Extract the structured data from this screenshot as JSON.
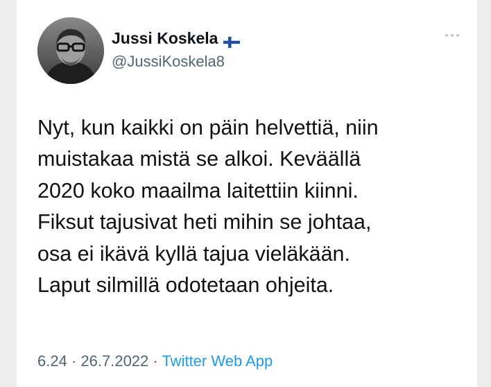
{
  "author": {
    "display_name": "Jussi Koskela",
    "handle": "@JussiKoskela8",
    "flag_icon": "finland-flag-icon",
    "avatar_icon": "profile-avatar"
  },
  "tweet": {
    "lines": [
      "Nyt, kun kaikki on päin helvettiä, niin",
      "muistakaa mistä se alkoi. Keväällä",
      "2020 koko maailma laitettiin kiinni.",
      "Fiksut tajusivat heti mihin se johtaa,",
      "osa ei ikävä kyllä tajua vieläkään.",
      "Laput silmillä odotetaan ohjeita."
    ]
  },
  "meta": {
    "time": "6.24",
    "separator": "·",
    "date": "26.7.2022",
    "source": "Twitter Web App"
  },
  "colors": {
    "link": "#1d9bf0",
    "secondary_text": "#536471",
    "primary_text": "#0f1419"
  }
}
